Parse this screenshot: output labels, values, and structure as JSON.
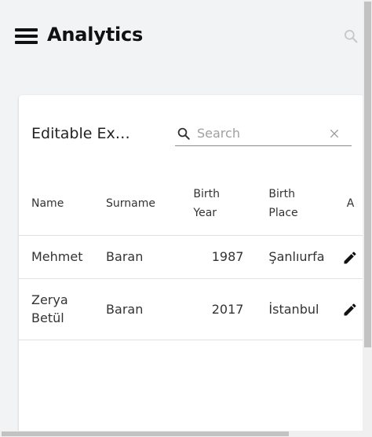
{
  "app": {
    "title": "Analytics"
  },
  "table_card": {
    "title": "Editable Ex…",
    "search": {
      "placeholder": "Search",
      "value": ""
    },
    "columns": [
      {
        "label": "Name"
      },
      {
        "label": "Surname"
      },
      {
        "label": "Birth Year"
      },
      {
        "label": "Birth Place"
      },
      {
        "label": "A"
      }
    ],
    "rows": [
      {
        "name": "Mehmet",
        "surname": "Baran",
        "birth_year": "1987",
        "birth_place": "Şanlıurfa"
      },
      {
        "name": "Zerya Betül",
        "surname": "Baran",
        "birth_year": "2017",
        "birth_place": "İstanbul"
      }
    ]
  },
  "icons": {
    "menu": "hamburger-menu-icon",
    "top_search": "search-icon",
    "table_search": "search-icon",
    "clear": "close-icon",
    "edit": "pencil-icon"
  },
  "colors": {
    "background": "#f1f3f5",
    "card": "#ffffff",
    "text": "#222222",
    "placeholder": "#a0a0a0"
  }
}
